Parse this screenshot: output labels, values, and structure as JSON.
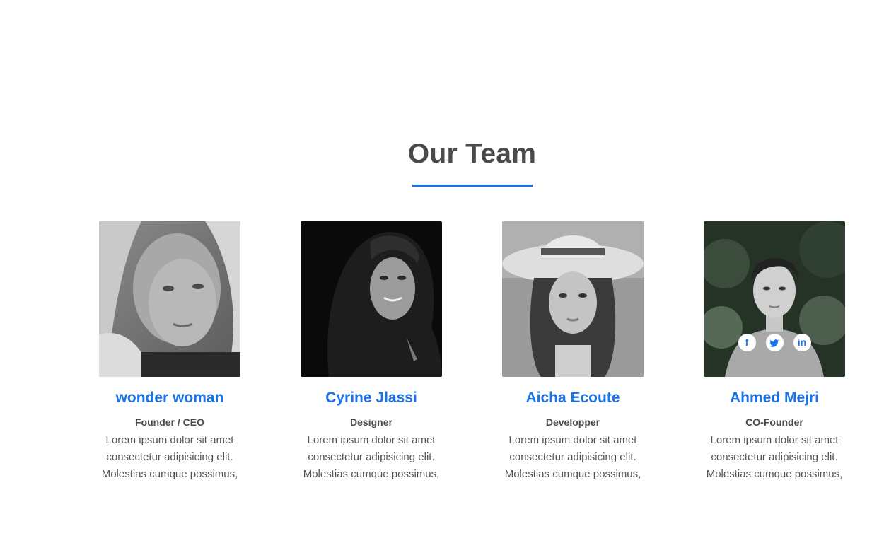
{
  "section": {
    "title": "Our Team"
  },
  "colors": {
    "accent": "#1a73e8",
    "heading": "#4a4a4a",
    "text": "#555555"
  },
  "members": [
    {
      "name": "wonder woman",
      "role": "Founder / CEO",
      "bio": [
        "Lorem ipsum dolor sit amet",
        "consectetur adipisicing elit.",
        "Molestias cumque possimus,"
      ]
    },
    {
      "name": "Cyrine Jlassi",
      "role": "Designer",
      "bio": [
        "Lorem ipsum dolor sit amet",
        "consectetur adipisicing elit.",
        "Molestias cumque possimus,"
      ]
    },
    {
      "name": "Aicha Ecoute",
      "role": "Developper",
      "bio": [
        "Lorem ipsum dolor sit amet",
        "consectetur adipisicing elit.",
        "Molestias cumque possimus,"
      ]
    },
    {
      "name": "Ahmed Mejri",
      "role": "CO-Founder",
      "bio": [
        "Lorem ipsum dolor sit amet",
        "consectetur adipisicing elit.",
        "Molestias cumque possimus,"
      ],
      "socials": [
        {
          "icon": "facebook-icon",
          "glyph": "f"
        },
        {
          "icon": "twitter-icon",
          "glyph": "t"
        },
        {
          "icon": "linkedin-icon",
          "glyph": "in"
        }
      ]
    }
  ]
}
